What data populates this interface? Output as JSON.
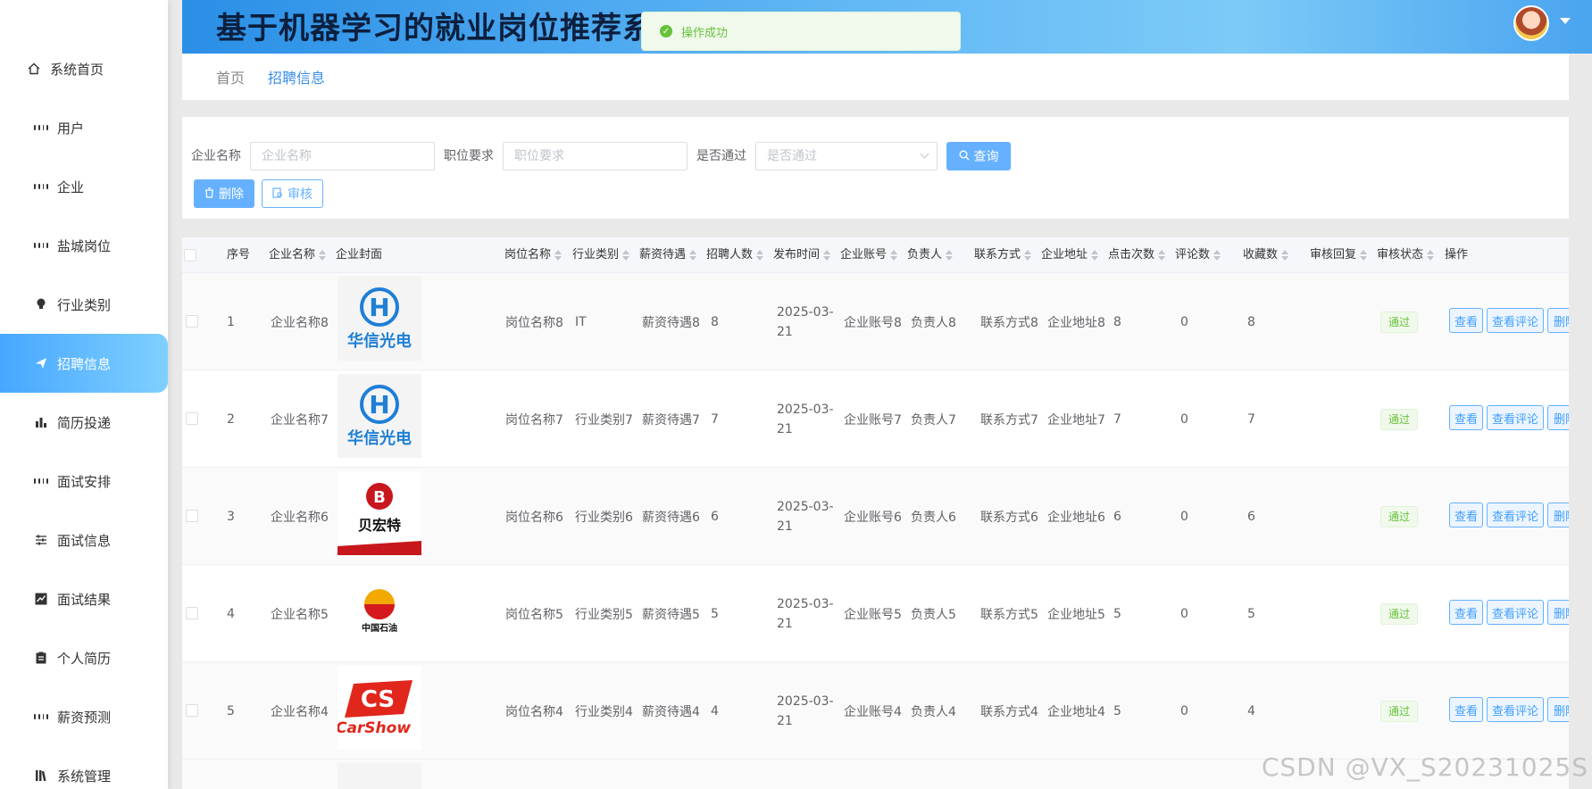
{
  "header": {
    "title": "基于机器学习的就业岗位推荐系统"
  },
  "toast": {
    "message": "操作成功"
  },
  "sidebar": {
    "items": [
      {
        "label": "系统首页",
        "icon": "home-icon"
      },
      {
        "label": "用户",
        "icon": "grid-icon"
      },
      {
        "label": "企业",
        "icon": "grid-icon"
      },
      {
        "label": "盐城岗位",
        "icon": "grid-icon"
      },
      {
        "label": "行业类别",
        "icon": "bulb-icon"
      },
      {
        "label": "招聘信息",
        "icon": "send-icon"
      },
      {
        "label": "简历投递",
        "icon": "bar-chart-icon"
      },
      {
        "label": "面试安排",
        "icon": "grid-icon"
      },
      {
        "label": "面试信息",
        "icon": "sliders-icon"
      },
      {
        "label": "面试结果",
        "icon": "line-chart-icon"
      },
      {
        "label": "个人简历",
        "icon": "clipboard-icon"
      },
      {
        "label": "薪资预测",
        "icon": "grid-icon"
      },
      {
        "label": "系统管理",
        "icon": "library-icon"
      }
    ]
  },
  "breadcrumb": {
    "home": "首页",
    "current": "招聘信息"
  },
  "search": {
    "company_label": "企业名称",
    "company_placeholder": "企业名称",
    "requirement_label": "职位要求",
    "requirement_placeholder": "职位要求",
    "passed_label": "是否通过",
    "passed_placeholder": "是否通过",
    "query_button": "查询",
    "delete_button": "删除",
    "audit_button": "审核"
  },
  "table": {
    "headers": {
      "index": "序号",
      "company": "企业名称",
      "cover": "企业封面",
      "position": "岗位名称",
      "industry": "行业类别",
      "salary": "薪资待遇",
      "headcount": "招聘人数",
      "published": "发布时间",
      "account": "企业账号",
      "contact": "负责人",
      "phone": "联系方式",
      "address": "企业地址",
      "clicks": "点击次数",
      "comments": "评论数",
      "favorites": "收藏数",
      "reply": "审核回复",
      "status": "审核状态",
      "actions": "操作"
    },
    "rows": [
      {
        "index": "1",
        "company": "企业名称8",
        "logo": "华信光电",
        "position": "岗位名称8",
        "industry": "IT",
        "salary": "薪资待遇8",
        "headcount": "8",
        "published": "2025-03-21",
        "account": "企业账号8",
        "contact": "负责人8",
        "phone": "联系方式8",
        "address": "企业地址8",
        "clicks": "8",
        "comments": "0",
        "favorites": "8",
        "status": "通过",
        "view": "查看",
        "view_comments": "查看评论",
        "delete": "删除"
      },
      {
        "index": "2",
        "company": "企业名称7",
        "logo": "华信光电",
        "position": "岗位名称7",
        "industry": "行业类别7",
        "salary": "薪资待遇7",
        "headcount": "7",
        "published": "2025-03-21",
        "account": "企业账号7",
        "contact": "负责人7",
        "phone": "联系方式7",
        "address": "企业地址7",
        "clicks": "7",
        "comments": "0",
        "favorites": "7",
        "status": "通过",
        "view": "查看",
        "view_comments": "查看评论",
        "delete": "删除"
      },
      {
        "index": "3",
        "company": "企业名称6",
        "logo": "贝宏特",
        "position": "岗位名称6",
        "industry": "行业类别6",
        "salary": "薪资待遇6",
        "headcount": "6",
        "published": "2025-03-21",
        "account": "企业账号6",
        "contact": "负责人6",
        "phone": "联系方式6",
        "address": "企业地址6",
        "clicks": "6",
        "comments": "0",
        "favorites": "6",
        "status": "通过",
        "view": "查看",
        "view_comments": "查看评论",
        "delete": "删除"
      },
      {
        "index": "4",
        "company": "企业名称5",
        "logo": "中国石油",
        "position": "岗位名称5",
        "industry": "行业类别5",
        "salary": "薪资待遇5",
        "headcount": "5",
        "published": "2025-03-21",
        "account": "企业账号5",
        "contact": "负责人5",
        "phone": "联系方式5",
        "address": "企业地址5",
        "clicks": "5",
        "comments": "0",
        "favorites": "5",
        "status": "通过",
        "view": "查看",
        "view_comments": "查看评论",
        "delete": "删除"
      },
      {
        "index": "5",
        "company": "企业名称4",
        "logo": "CarShow",
        "position": "岗位名称4",
        "industry": "行业类别4",
        "salary": "薪资待遇4",
        "headcount": "4",
        "published": "2025-03-21",
        "account": "企业账号4",
        "contact": "负责人4",
        "phone": "联系方式4",
        "address": "企业地址4",
        "clicks": "5",
        "comments": "0",
        "favorites": "4",
        "status": "通过",
        "view": "查看",
        "view_comments": "查看评论",
        "delete": "删除"
      }
    ]
  },
  "watermark": "CSDN @VX_S20231025S",
  "colors": {
    "accent": "#409eff",
    "success": "#67c23a",
    "active_gradient_start": "#47a7ff"
  }
}
